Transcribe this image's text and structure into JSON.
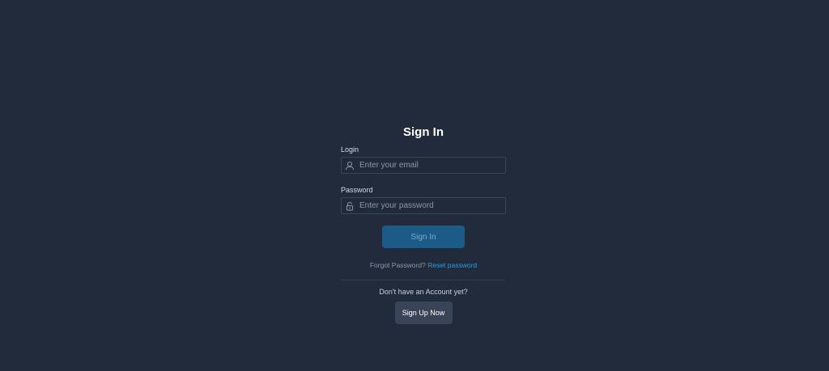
{
  "form": {
    "title": "Sign In",
    "login": {
      "label": "Login",
      "placeholder": "Enter your email",
      "icon": "user-icon"
    },
    "password": {
      "label": "Password",
      "placeholder": "Enter your password",
      "icon": "lock-icon"
    },
    "submit_label": "Sign In",
    "forgot_text": "Forgot Password?",
    "reset_link": "Reset password",
    "no_account_text": "Don't have an Account yet?",
    "signup_label": "Sign Up Now"
  },
  "colors": {
    "background": "#222b3c",
    "primary_button": "#1c5a87",
    "secondary_button": "#3a4459",
    "link": "#2e9bd6"
  }
}
